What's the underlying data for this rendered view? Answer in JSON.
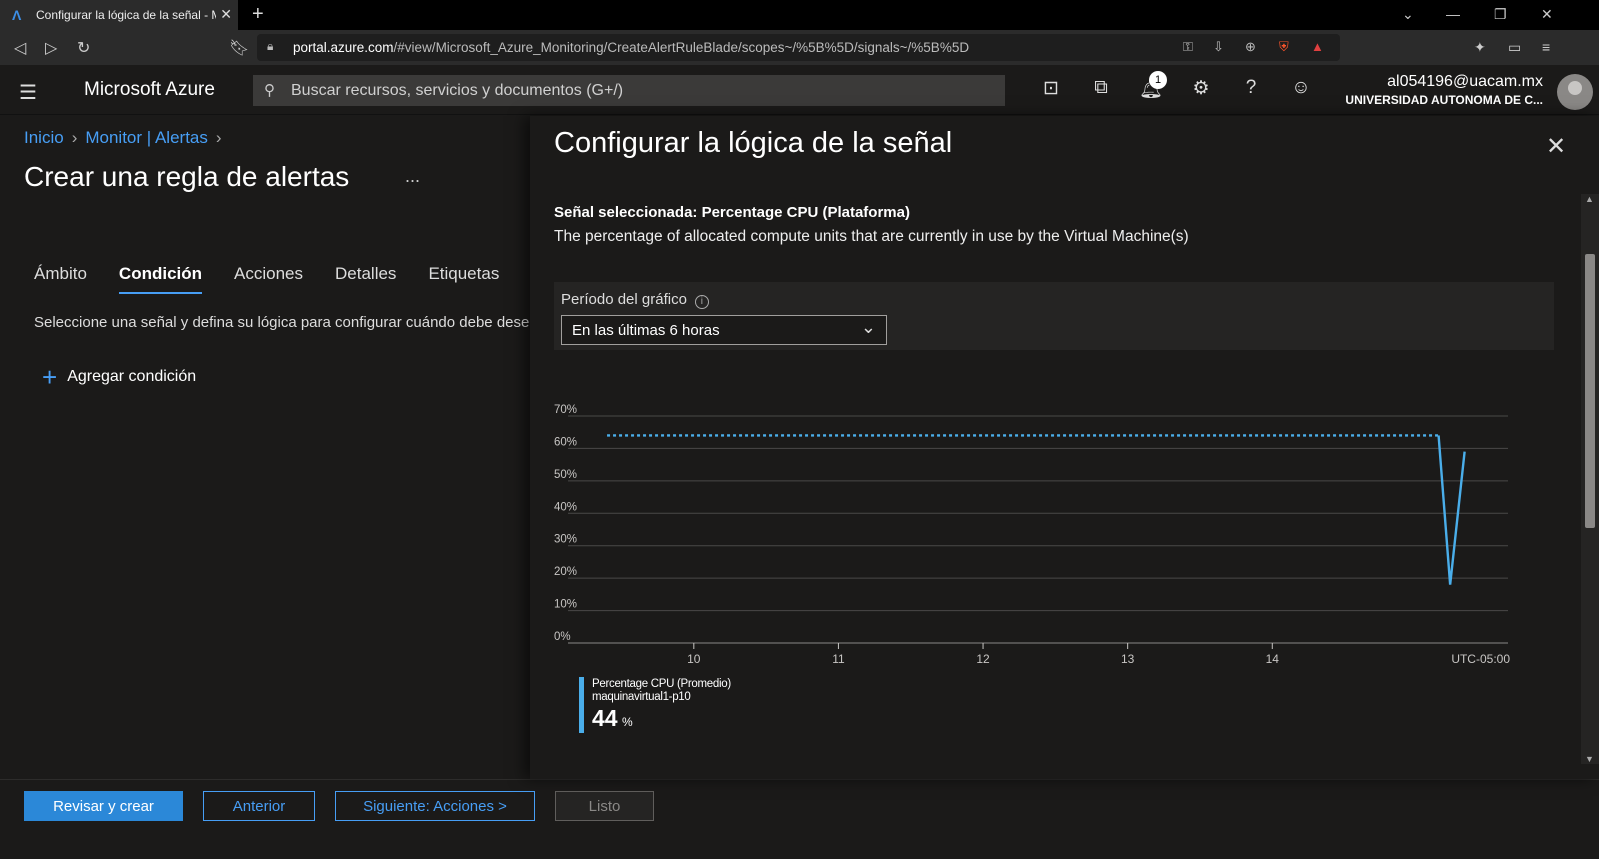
{
  "browser": {
    "tab_title": "Configurar la lógica de la señal - Micros",
    "url_host": "portal.azure.com",
    "url_path": "/#view/Microsoft_Azure_Monitoring/CreateAlertRuleBlade/scopes~/%5B%5D/signals~/%5B%5D"
  },
  "header": {
    "brand": "Microsoft Azure",
    "search_placeholder": "Buscar recursos, servicios y documentos (G+/)",
    "notification_count": "1",
    "user_email": "al054196@uacam.mx",
    "user_org": "UNIVERSIDAD AUTONOMA DE C..."
  },
  "left": {
    "breadcrumbs": [
      "Inicio",
      "Monitor | Alertas"
    ],
    "title": "Crear una regla de alertas",
    "ellipsis": "...",
    "tabs": [
      "Ámbito",
      "Condición",
      "Acciones",
      "Detalles",
      "Etiquetas"
    ],
    "active_tab": "Condición",
    "description": "Seleccione una señal y defina su lógica para configurar cuándo debe desencadenarse la alerta.",
    "add_condition": "Agregar condición"
  },
  "footer": {
    "review_create": "Revisar y crear",
    "previous": "Anterior",
    "next": "Siguiente: Acciones >",
    "done": "Listo"
  },
  "blade": {
    "title": "Configurar la lógica de la señal",
    "signal_title": "Señal seleccionada: Percentage CPU (Plataforma)",
    "signal_desc": "The percentage of allocated compute units that are currently in use by the Virtual Machine(s)",
    "period_label": "Período del gráfico",
    "period_value": "En las últimas 6 horas"
  },
  "chart_data": {
    "type": "line",
    "y_ticks": [
      "0%",
      "10%",
      "20%",
      "30%",
      "40%",
      "50%",
      "60%",
      "70%"
    ],
    "ylim": [
      0,
      70
    ],
    "x_ticks": [
      "10",
      "11",
      "12",
      "13",
      "14"
    ],
    "x_tick_hours": [
      10,
      11,
      12,
      13,
      14
    ],
    "xlim": [
      9.13,
      15.63
    ],
    "timezone": "UTC-05:00",
    "series": [
      {
        "name": "Percentage CPU (Promedio)",
        "resource": "maquinavirtual1-p10",
        "color": "#4aaeea",
        "dashed_segment": {
          "x": [
            9.4,
            15.15
          ],
          "y": [
            64,
            64
          ]
        },
        "solid_segment": {
          "x": [
            15.15,
            15.23,
            15.33
          ],
          "y": [
            64,
            18,
            59
          ]
        }
      }
    ],
    "legend_value": "44",
    "legend_unit": "%"
  }
}
